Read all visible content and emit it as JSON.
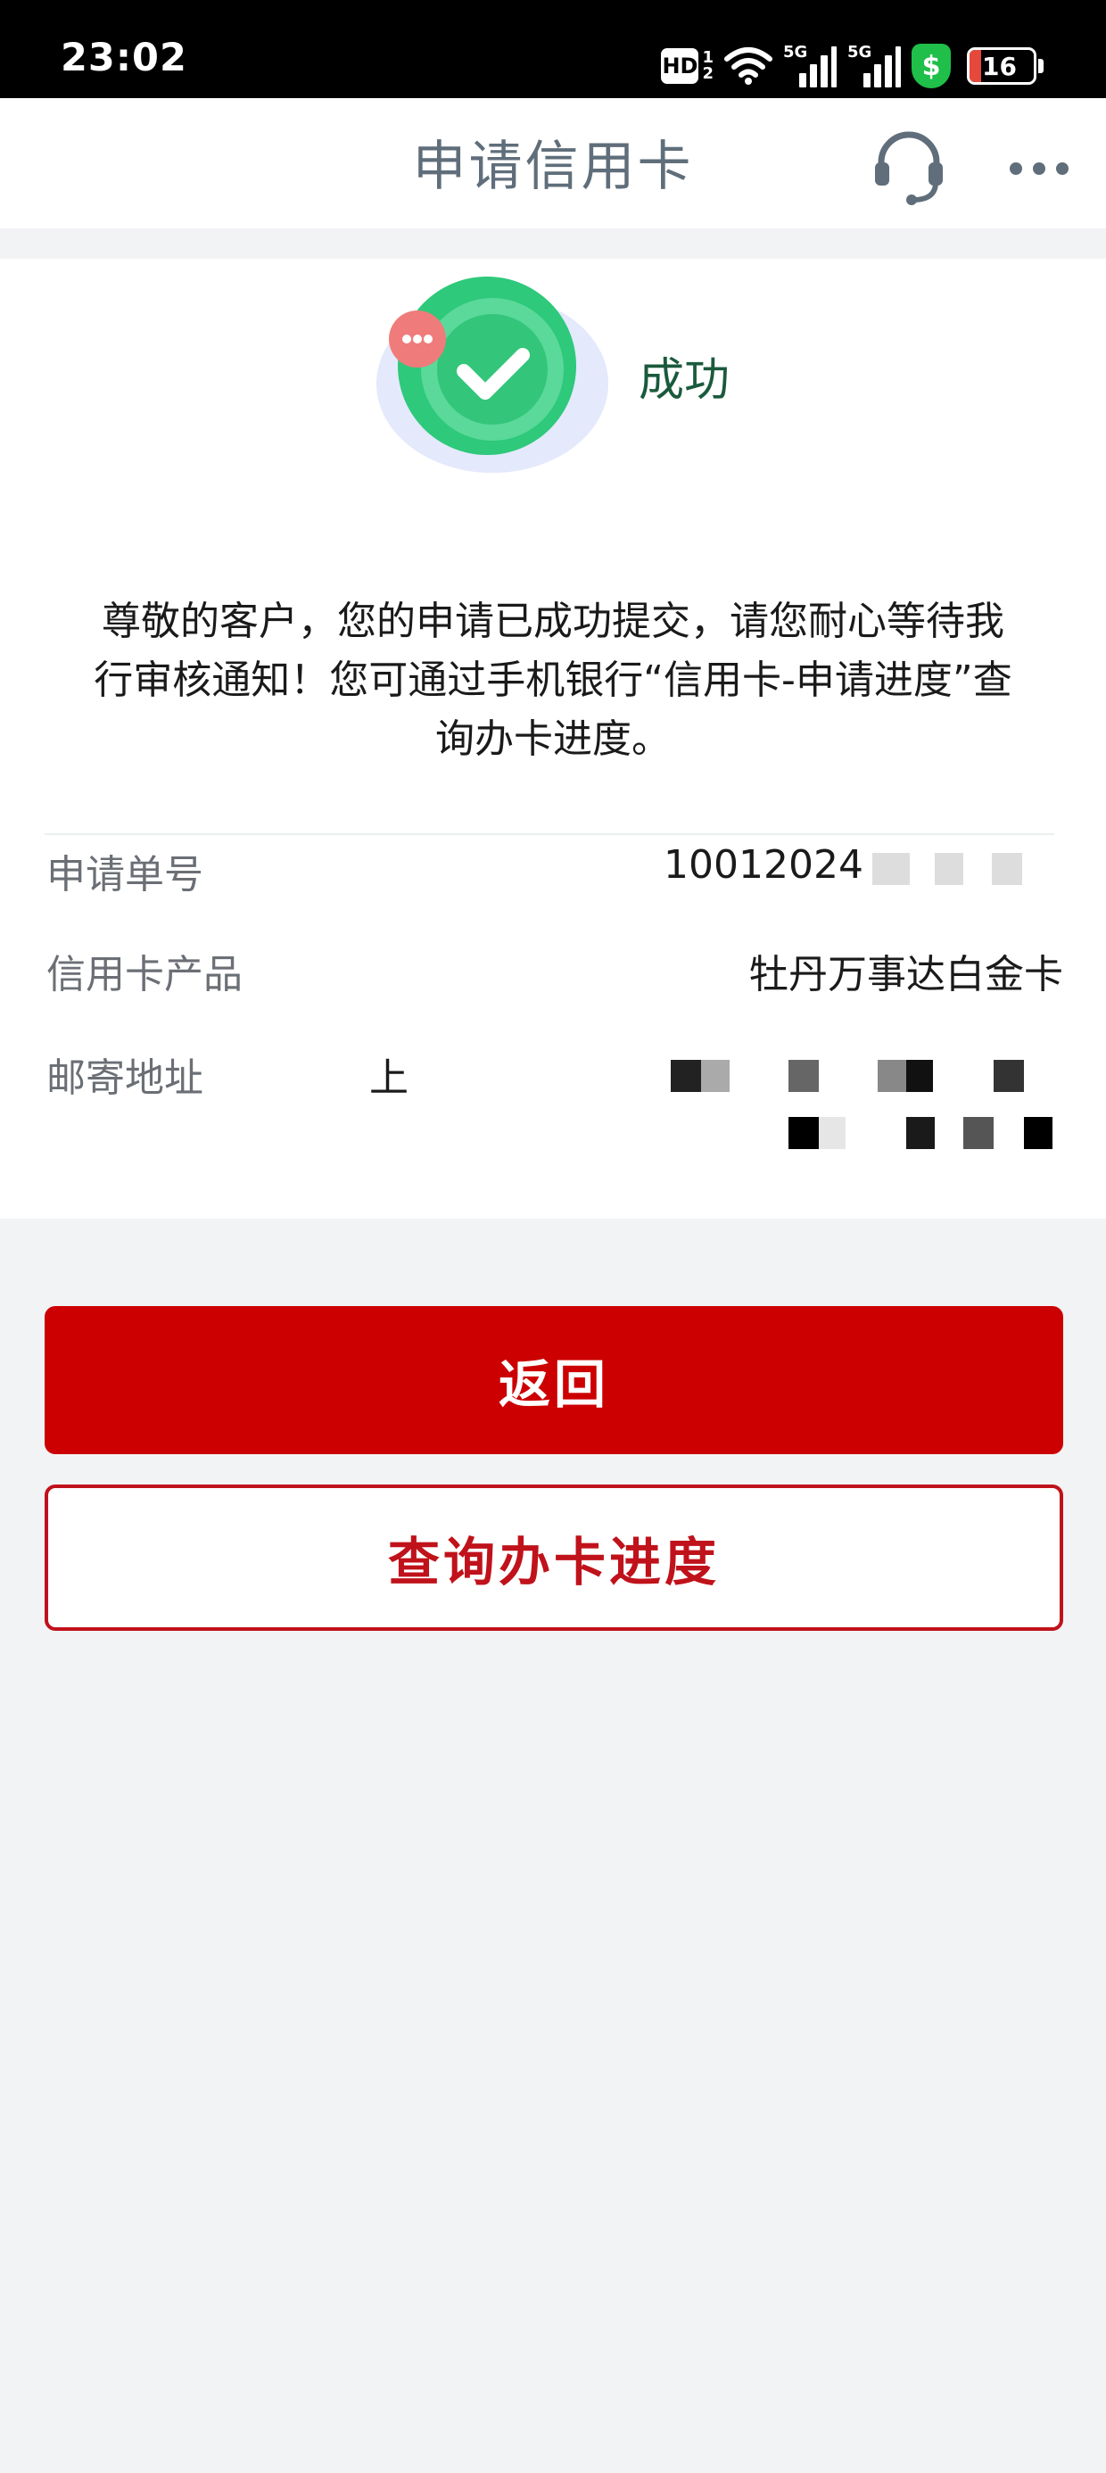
{
  "status_bar": {
    "time": "23:02",
    "hd_label": "HD",
    "hd_sub": "1 2",
    "network_1": "5G",
    "network_2": "5G",
    "battery_level": "16"
  },
  "nav": {
    "title": "申请信用卡",
    "service_icon": "headset-icon",
    "more_icon": "more-icon"
  },
  "result": {
    "status_label": "成功",
    "message": "尊敬的客户，您的申请已成功提交，请您耐心等待我行审核通知！您可通过手机银行“信用卡-申请进度”查询办卡进度。"
  },
  "details": {
    "application_no_label": "申请单号",
    "application_no_value": "10012024",
    "product_label": "信用卡产品",
    "product_value": "牡丹万事达白金卡",
    "address_label": "邮寄地址",
    "address_value": "上"
  },
  "actions": {
    "back_label": "返回",
    "query_label": "查询办卡进度"
  },
  "colors": {
    "primary_red": "#cc0000",
    "success_green": "#2ec97a",
    "page_bg": "#f2f3f5"
  }
}
